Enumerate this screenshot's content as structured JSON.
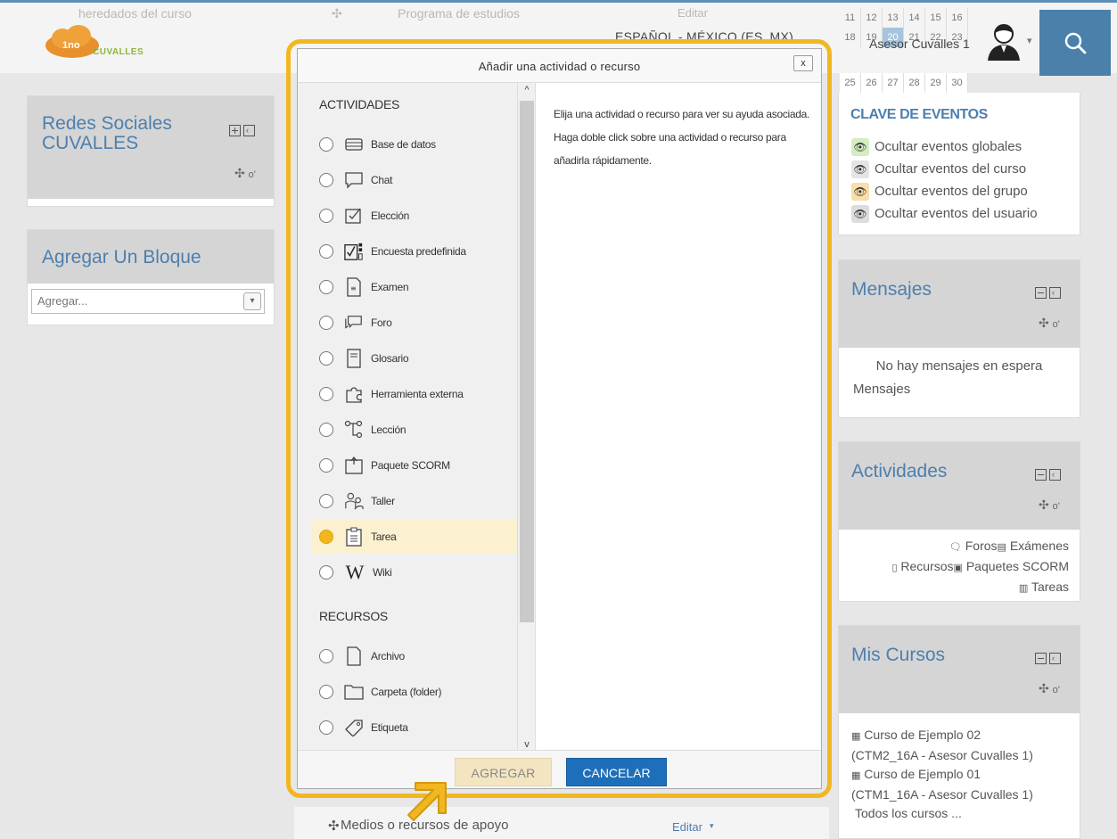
{
  "header": {
    "brand": "CUVALLES",
    "faded_course_text": "heredados del curso",
    "faded_course_text2": "Programa de estudios",
    "faded_edit": "Editar",
    "language": "ESPAÑOL - MÉXICO (ES_MX)",
    "user_name": "Asesor Cuvalles 1"
  },
  "calendar": {
    "row1": [
      "11",
      "12",
      "13",
      "14",
      "15",
      "16",
      ""
    ],
    "row2": [
      "18",
      "19",
      "20",
      "21",
      "22",
      "23",
      ""
    ],
    "row3": [
      "25",
      "26",
      "27",
      "28",
      "29",
      "30",
      ""
    ]
  },
  "left_blocks": {
    "social_title": "Redes Sociales CUVALLES",
    "add_block_title": "Agregar Un Bloque",
    "add_block_select": "Agregar..."
  },
  "events": {
    "title": "CLAVE DE EVENTOS",
    "items": [
      "Ocultar eventos globales",
      "Ocultar eventos del curso",
      "Ocultar eventos del grupo",
      "Ocultar eventos del usuario"
    ],
    "colors": [
      "#d6ecc3",
      "#e4e4e4",
      "#f7deaa",
      "#dcdcdc"
    ]
  },
  "messages": {
    "title": "Mensajes",
    "empty": "No hay mensajes en espera",
    "link": "Mensajes"
  },
  "activities_block": {
    "title": "Actividades",
    "line1": "Foros",
    "line1b": "Exámenes",
    "line2": "Recursos",
    "line2b": "Paquetes SCORM",
    "line3": "Tareas"
  },
  "my_courses": {
    "title": "Mis Cursos",
    "course1": "Curso de Ejemplo 02",
    "course1_detail": "(CTM2_16A - Asesor Cuvalles 1)",
    "course2": "Curso de Ejemplo 01",
    "course2_detail": "(CTM1_16A - Asesor Cuvalles 1)",
    "all": "Todos los cursos ..."
  },
  "bottom_course": {
    "label": "Medios o recursos de apoyo",
    "edit": "Editar"
  },
  "modal": {
    "title": "Añadir una actividad o recurso",
    "close": "x",
    "section_activities": "ACTIVIDADES",
    "section_resources": "RECURSOS",
    "activities": [
      "Base de datos",
      "Chat",
      "Elección",
      "Encuesta predefinida",
      "Examen",
      "Foro",
      "Glosario",
      "Herramienta externa",
      "Lección",
      "Paquete SCORM",
      "Taller",
      "Tarea",
      "Wiki"
    ],
    "resources": [
      "Archivo",
      "Carpeta (folder)",
      "Etiqueta"
    ],
    "selected": "Tarea",
    "help": "Elija una actividad o recurso para ver su ayuda asociada. Haga doble click sobre una actividad o recurso para añadirla rápidamente.",
    "add_button": "AGREGAR",
    "cancel_button": "CANCELAR",
    "highlight_color": "#f2b620"
  }
}
